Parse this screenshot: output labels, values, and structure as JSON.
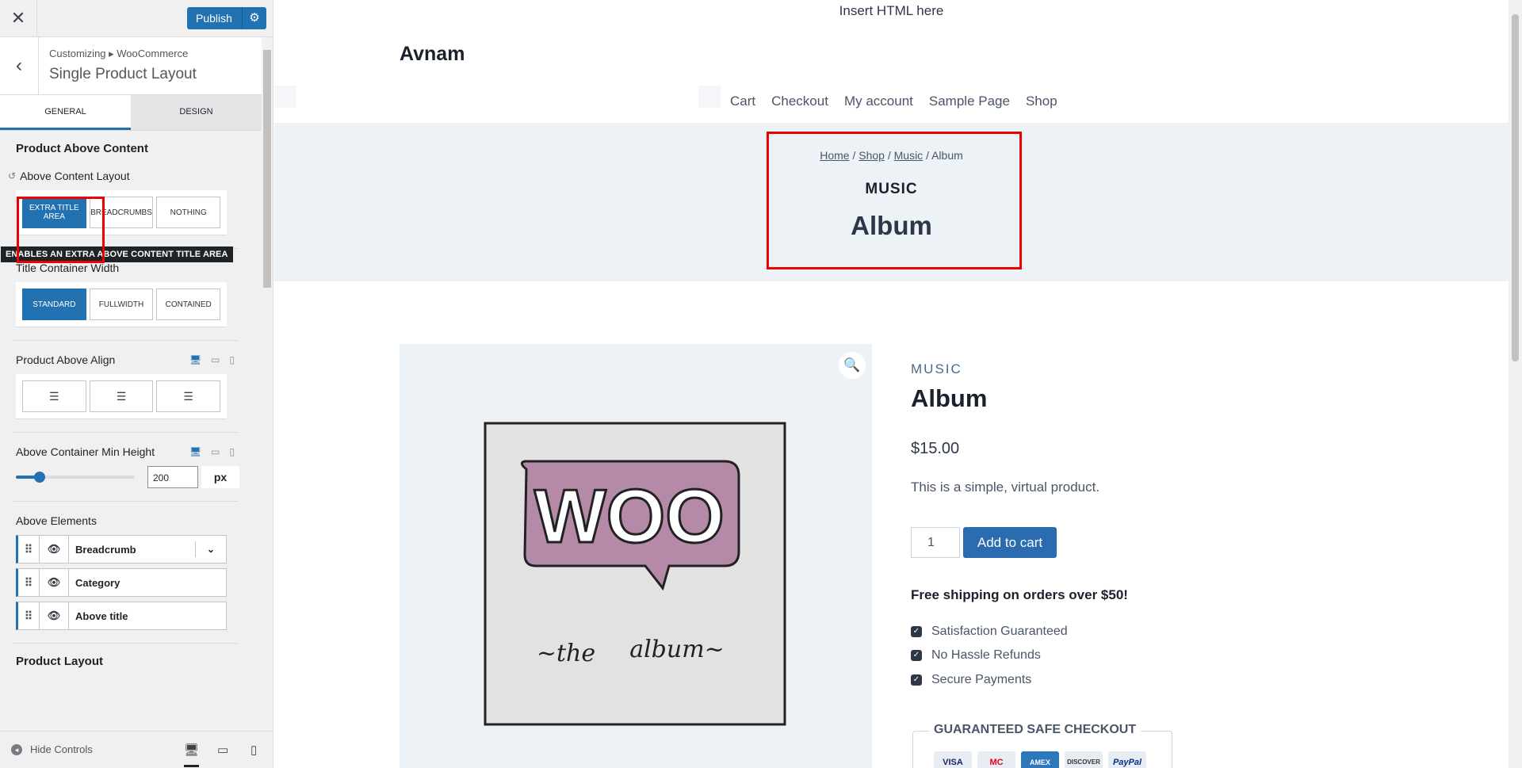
{
  "sidebar": {
    "close_label": "✕",
    "publish_label": "Publish",
    "breadcrumb": "Customizing ▸ WooCommerce",
    "section_title": "Single Product Layout",
    "tabs": [
      "GENERAL",
      "DESIGN"
    ],
    "panel_title": "Product Above Content",
    "above_content_layout": {
      "label": "Above Content Layout",
      "options": [
        "EXTRA TITLE AREA",
        "BREADCRUMBS",
        "NOTHING"
      ],
      "selected": "EXTRA TITLE AREA",
      "tooltip": "ENABLES AN EXTRA ABOVE CONTENT TITLE AREA"
    },
    "title_container_width": {
      "label": "Title Container Width",
      "options": [
        "STANDARD",
        "FULLWIDTH",
        "CONTAINED"
      ],
      "selected": "STANDARD"
    },
    "product_above_align": {
      "label": "Product Above Align"
    },
    "min_height": {
      "label": "Above Container Min Height",
      "value": "200",
      "unit": "px",
      "slider_fraction": 0.2
    },
    "above_elements": {
      "label": "Above Elements",
      "items": [
        "Breadcrumb",
        "Category",
        "Above title"
      ]
    },
    "next_section_partial": "Product Layout",
    "hide_controls": "Hide Controls"
  },
  "preview": {
    "top_text": "Insert HTML here",
    "site_title": "Avnam",
    "nav": [
      "Cart",
      "Checkout",
      "My account",
      "Sample Page",
      "Shop"
    ],
    "hero": {
      "breadcrumb": [
        "Home",
        "Shop",
        "Music",
        "Album"
      ],
      "separator": " / ",
      "category": "MUSIC",
      "title": "Album"
    },
    "product": {
      "category": "MUSIC",
      "title": "Album",
      "price": "$15.00",
      "description": "This is a simple, virtual product.",
      "quantity": "1",
      "add_to_cart": "Add to cart",
      "shipping_note": "Free shipping on orders over $50!",
      "features": [
        "Satisfaction Guaranteed",
        "No Hassle Refunds",
        "Secure Payments"
      ],
      "checkout_box_title": "GUARANTEED SAFE CHECKOUT",
      "cards": [
        "VISA",
        "MC",
        "AMEX",
        "DISCOVER",
        "PayPal"
      ],
      "image_text": [
        "WOO",
        "~the",
        "album~"
      ]
    }
  },
  "colors": {
    "accent": "#2271b1",
    "highlight_box": "#e00000",
    "hero_bg": "#edf2f7",
    "button": "#2b6cb0"
  }
}
